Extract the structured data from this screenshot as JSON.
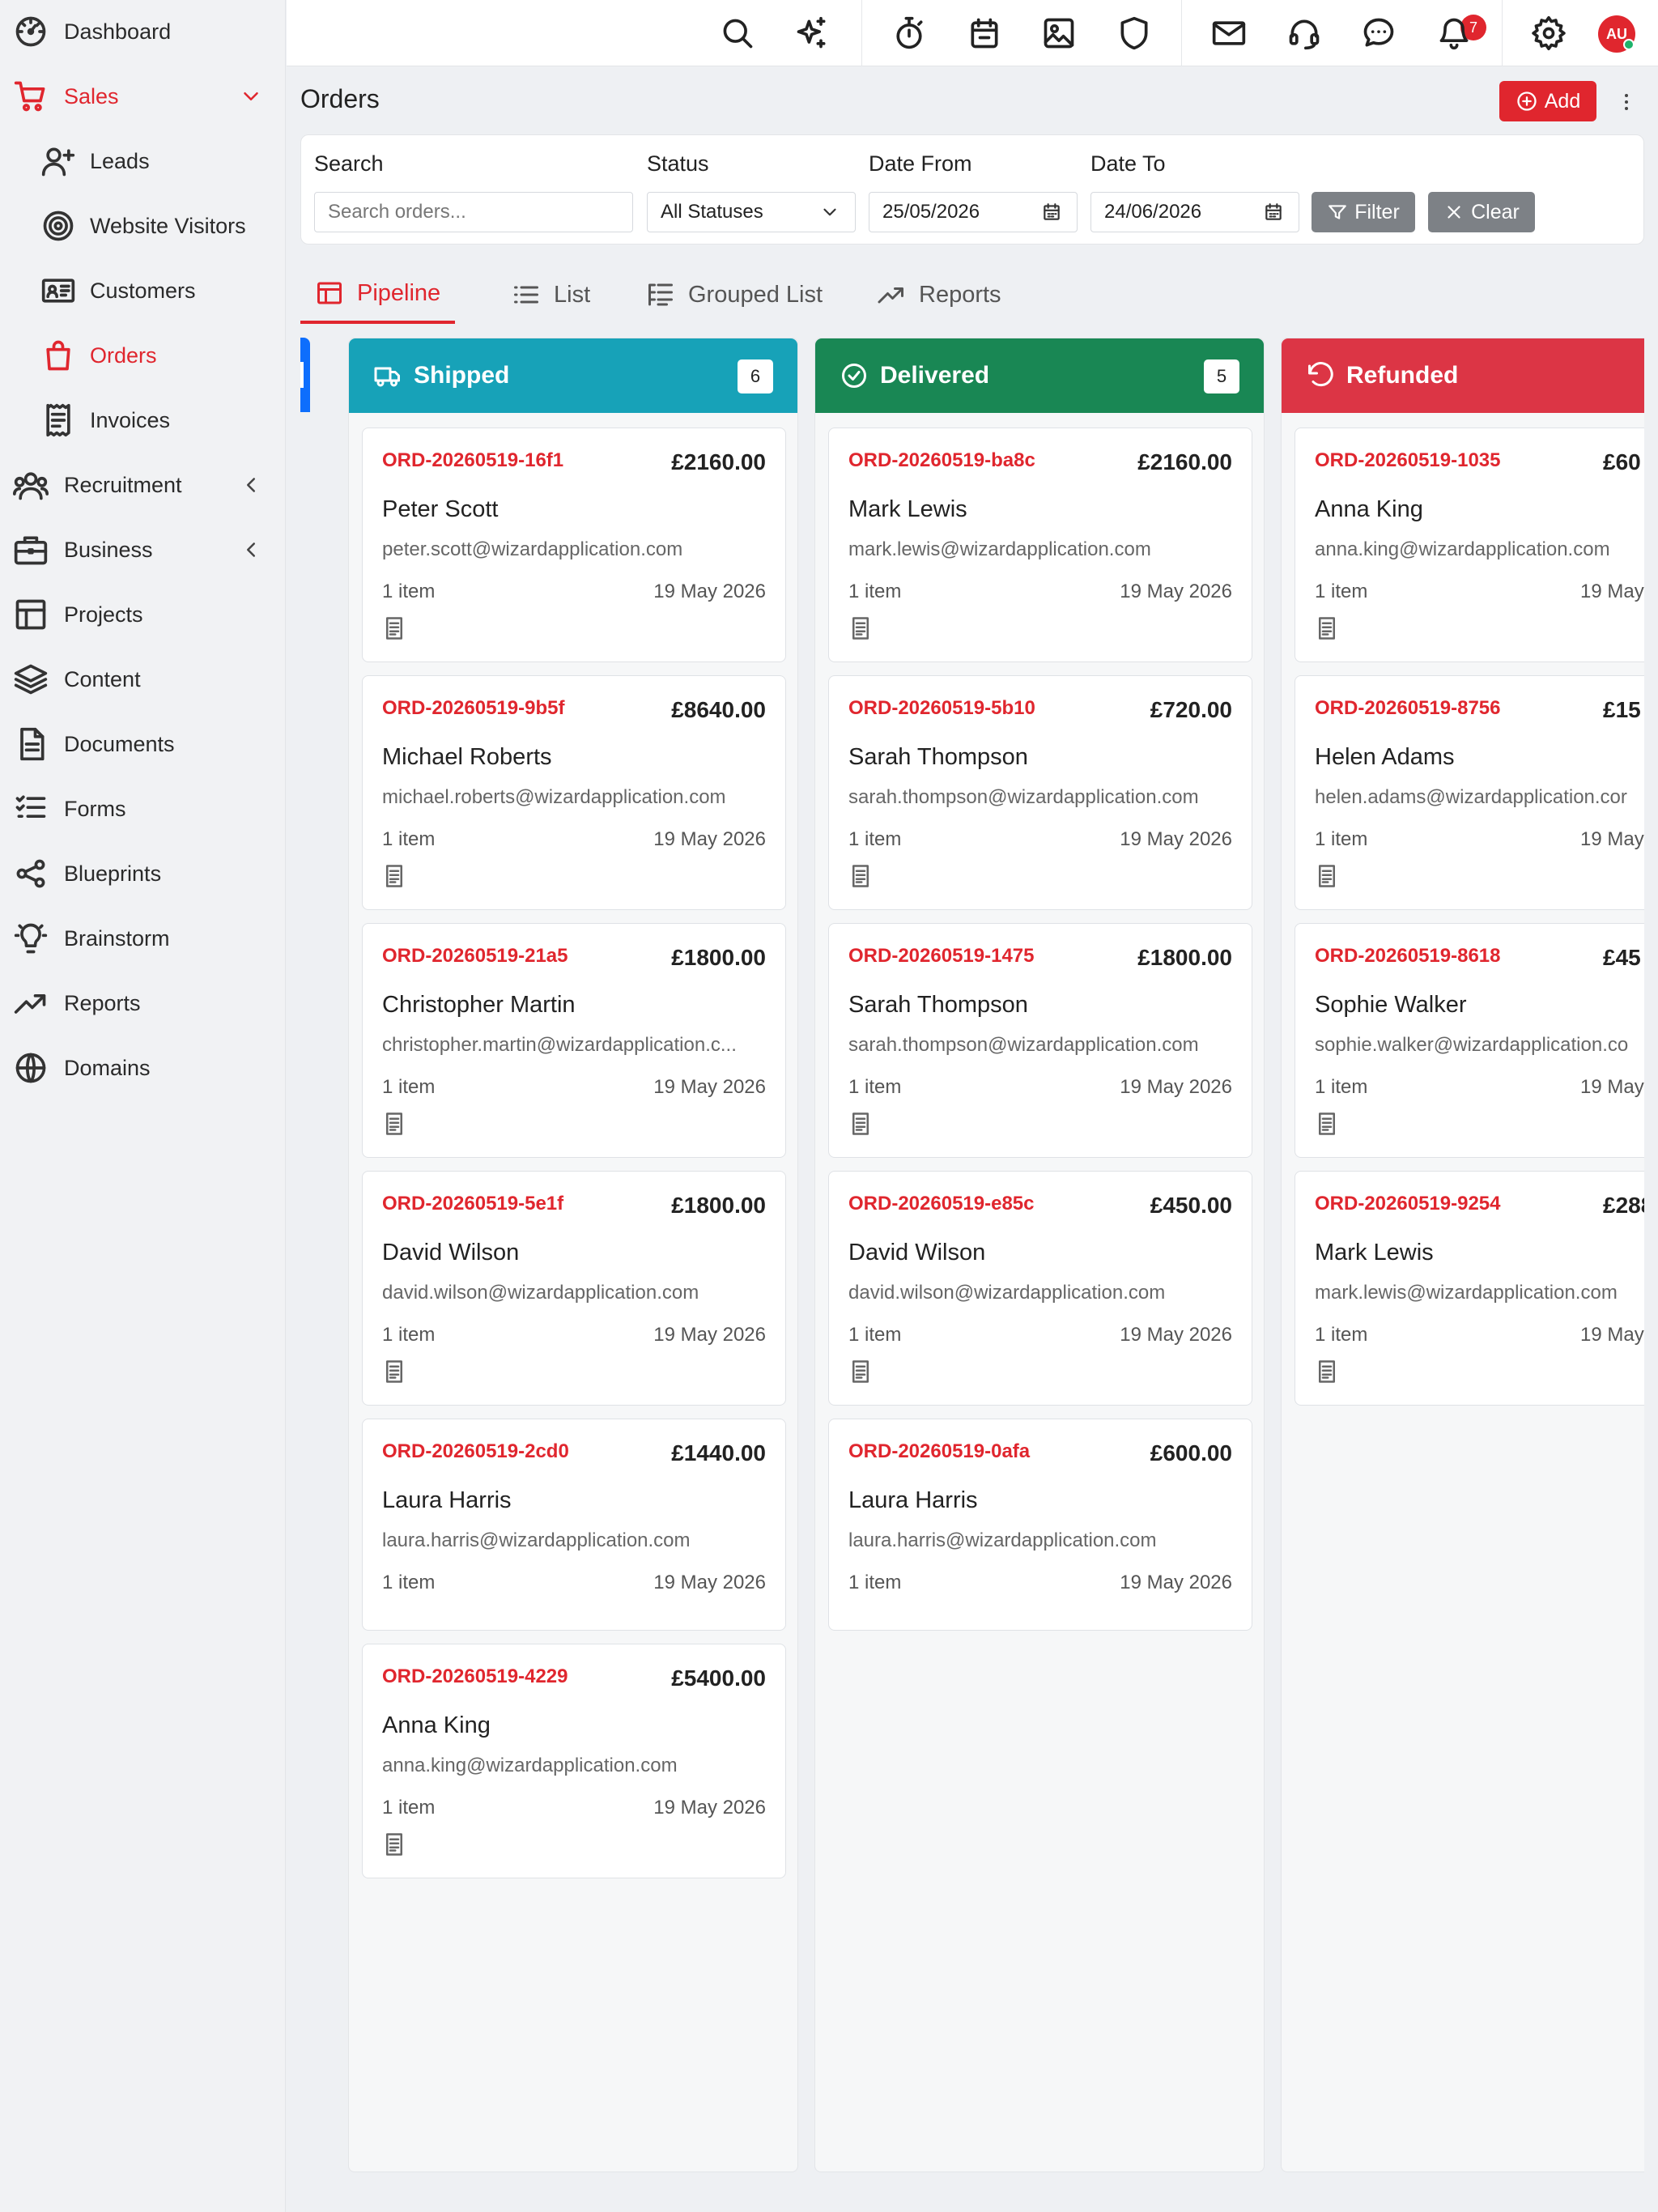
{
  "sidebar": {
    "items": [
      {
        "label": "Dashboard",
        "icon": "dashboard-icon"
      },
      {
        "label": "Sales",
        "icon": "cart-icon"
      },
      {
        "label": "Leads",
        "icon": "user-plus-icon"
      },
      {
        "label": "Website Visitors",
        "icon": "target-icon"
      },
      {
        "label": "Customers",
        "icon": "id-card-icon"
      },
      {
        "label": "Orders",
        "icon": "shopping-bag-icon"
      },
      {
        "label": "Invoices",
        "icon": "receipt-icon"
      },
      {
        "label": "Recruitment",
        "icon": "users-icon"
      },
      {
        "label": "Business",
        "icon": "briefcase-icon"
      },
      {
        "label": "Projects",
        "icon": "layout-icon"
      },
      {
        "label": "Content",
        "icon": "layers-icon"
      },
      {
        "label": "Documents",
        "icon": "document-icon"
      },
      {
        "label": "Forms",
        "icon": "list-check-icon"
      },
      {
        "label": "Blueprints",
        "icon": "share-nodes-icon"
      },
      {
        "label": "Brainstorm",
        "icon": "lightbulb-icon"
      },
      {
        "label": "Reports",
        "icon": "trend-icon"
      },
      {
        "label": "Domains",
        "icon": "globe-icon"
      }
    ]
  },
  "topbar": {
    "icons": [
      "search-icon",
      "sparkles-icon",
      "stopwatch-icon",
      "calendar-icon",
      "image-icon",
      "shield-icon",
      "mail-icon",
      "headset-icon",
      "chat-icon",
      "bell-icon",
      "gear-icon"
    ],
    "notification_count": "7",
    "avatar_initials": "AU"
  },
  "page": {
    "title": "Orders",
    "add_label": "Add"
  },
  "filters": {
    "search_label": "Search",
    "search_placeholder": "Search orders...",
    "status_label": "Status",
    "status_value": "All Statuses",
    "date_from_label": "Date From",
    "date_from_value": "25/05/2026",
    "date_to_label": "Date To",
    "date_to_value": "24/06/2026",
    "filter_label": "Filter",
    "clear_label": "Clear"
  },
  "tabs": [
    {
      "label": "Pipeline",
      "icon": "pipeline-icon"
    },
    {
      "label": "List",
      "icon": "list-icon"
    },
    {
      "label": "Grouped List",
      "icon": "grouped-list-icon"
    },
    {
      "label": "Reports",
      "icon": "trend-icon"
    }
  ],
  "colors": {
    "accent": "#e0262e",
    "shipped": "#17a2b8",
    "delivered": "#198754",
    "refunded": "#dc3545",
    "prev_column": "#0d6efd"
  },
  "columns": [
    {
      "title": "Shipped",
      "count": "6",
      "icon": "truck-icon",
      "cards": [
        {
          "id": "ORD-20260519-16f1",
          "amount": "£2160.00",
          "name": "Peter Scott",
          "email": "peter.scott@wizardapplication.com",
          "items": "1 item",
          "date": "19 May 2026",
          "has_doc": true
        },
        {
          "id": "ORD-20260519-9b5f",
          "amount": "£8640.00",
          "name": "Michael Roberts",
          "email": "michael.roberts@wizardapplication.com",
          "items": "1 item",
          "date": "19 May 2026",
          "has_doc": true
        },
        {
          "id": "ORD-20260519-21a5",
          "amount": "£1800.00",
          "name": "Christopher Martin",
          "email": "christopher.martin@wizardapplication.c...",
          "items": "1 item",
          "date": "19 May 2026",
          "has_doc": true
        },
        {
          "id": "ORD-20260519-5e1f",
          "amount": "£1800.00",
          "name": "David Wilson",
          "email": "david.wilson@wizardapplication.com",
          "items": "1 item",
          "date": "19 May 2026",
          "has_doc": true
        },
        {
          "id": "ORD-20260519-2cd0",
          "amount": "£1440.00",
          "name": "Laura Harris",
          "email": "laura.harris@wizardapplication.com",
          "items": "1 item",
          "date": "19 May 2026",
          "has_doc": false
        },
        {
          "id": "ORD-20260519-4229",
          "amount": "£5400.00",
          "name": "Anna King",
          "email": "anna.king@wizardapplication.com",
          "items": "1 item",
          "date": "19 May 2026",
          "has_doc": true
        }
      ]
    },
    {
      "title": "Delivered",
      "count": "5",
      "icon": "check-circle-icon",
      "cards": [
        {
          "id": "ORD-20260519-ba8c",
          "amount": "£2160.00",
          "name": "Mark Lewis",
          "email": "mark.lewis@wizardapplication.com",
          "items": "1 item",
          "date": "19 May 2026",
          "has_doc": true
        },
        {
          "id": "ORD-20260519-5b10",
          "amount": "£720.00",
          "name": "Sarah Thompson",
          "email": "sarah.thompson@wizardapplication.com",
          "items": "1 item",
          "date": "19 May 2026",
          "has_doc": true
        },
        {
          "id": "ORD-20260519-1475",
          "amount": "£1800.00",
          "name": "Sarah Thompson",
          "email": "sarah.thompson@wizardapplication.com",
          "items": "1 item",
          "date": "19 May 2026",
          "has_doc": true
        },
        {
          "id": "ORD-20260519-e85c",
          "amount": "£450.00",
          "name": "David Wilson",
          "email": "david.wilson@wizardapplication.com",
          "items": "1 item",
          "date": "19 May 2026",
          "has_doc": true
        },
        {
          "id": "ORD-20260519-0afa",
          "amount": "£600.00",
          "name": "Laura Harris",
          "email": "laura.harris@wizardapplication.com",
          "items": "1 item",
          "date": "19 May 2026",
          "has_doc": false
        }
      ]
    },
    {
      "title": "Refunded",
      "count": "",
      "icon": "undo-icon",
      "cards": [
        {
          "id": "ORD-20260519-1035",
          "amount": "£60",
          "name": "Anna King",
          "email": "anna.king@wizardapplication.com",
          "items": "1 item",
          "date": "19 May",
          "has_doc": true
        },
        {
          "id": "ORD-20260519-8756",
          "amount": "£15",
          "name": "Helen Adams",
          "email": "helen.adams@wizardapplication.cor",
          "items": "1 item",
          "date": "19 May",
          "has_doc": true
        },
        {
          "id": "ORD-20260519-8618",
          "amount": "£45",
          "name": "Sophie Walker",
          "email": "sophie.walker@wizardapplication.co",
          "items": "1 item",
          "date": "19 May",
          "has_doc": true
        },
        {
          "id": "ORD-20260519-9254",
          "amount": "£288",
          "name": "Mark Lewis",
          "email": "mark.lewis@wizardapplication.com",
          "items": "1 item",
          "date": "19 May",
          "has_doc": true
        }
      ]
    }
  ]
}
